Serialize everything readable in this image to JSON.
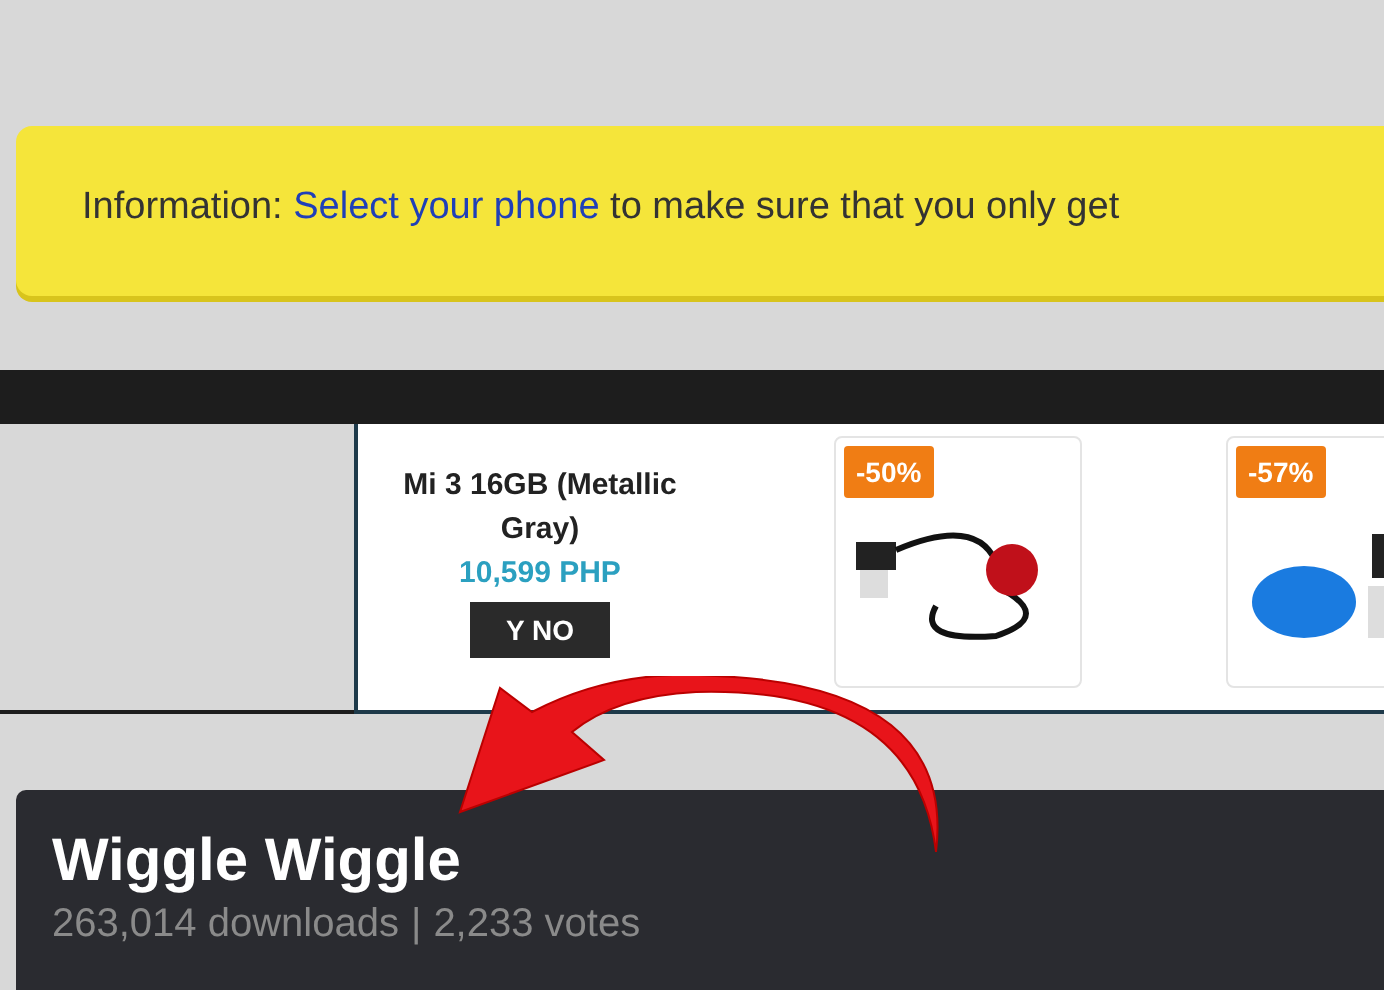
{
  "info_bar": {
    "prefix": "Information: ",
    "link": "Select your phone",
    "suffix": " to make sure that you only get"
  },
  "ad_banner": {
    "products": [
      {
        "kind": "phone",
        "name": "Mi 3 16GB (Metallic Gray)",
        "price": "10,599 PHP",
        "button": "Y NO"
      },
      {
        "kind": "deal",
        "badge": "-50%"
      },
      {
        "kind": "deal",
        "badge": "-57%"
      }
    ]
  },
  "app": {
    "title": "Wiggle Wiggle",
    "downloads": "263,014 downloads",
    "separator": "|",
    "votes": "2,233 votes"
  }
}
